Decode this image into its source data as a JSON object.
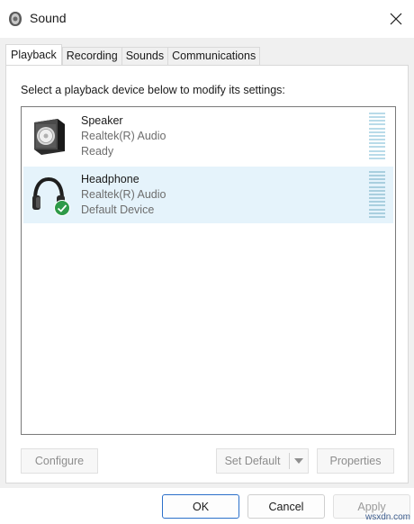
{
  "window": {
    "title": "Sound",
    "app_icon": "speaker-icon",
    "close_icon": "close-icon"
  },
  "tabs": [
    {
      "label": "Playback",
      "active": true
    },
    {
      "label": "Recording",
      "active": false
    },
    {
      "label": "Sounds",
      "active": false
    },
    {
      "label": "Communications",
      "active": false
    }
  ],
  "playback": {
    "instruction": "Select a playback device below to modify its settings:",
    "devices": [
      {
        "name": "Speaker",
        "driver": "Realtek(R) Audio",
        "status": "Ready",
        "icon": "speaker-device-icon",
        "selected": false
      },
      {
        "name": "Headphone",
        "driver": "Realtek(R) Audio",
        "status": "Default Device",
        "icon": "headphone-device-icon",
        "badge": "default-check-icon",
        "selected": true
      }
    ],
    "buttons": {
      "configure": "Configure",
      "set_default": "Set Default",
      "properties": "Properties"
    }
  },
  "footer": {
    "ok": "OK",
    "cancel": "Cancel",
    "apply": "Apply"
  },
  "watermark": "wsxdn.com",
  "colors": {
    "selection_bg": "#e5f3fb",
    "accent_border": "#2a6fc9",
    "check_green": "#2e9a48"
  }
}
